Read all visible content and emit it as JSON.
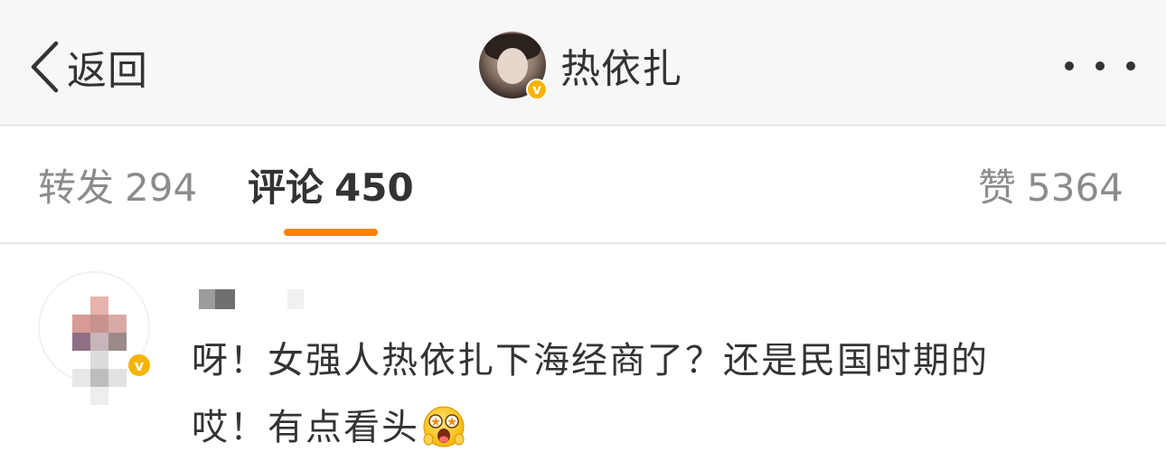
{
  "navbar": {
    "back_label": "返回",
    "back_icon": "chevron-left-icon",
    "title": "热依扎",
    "verified_badge": "v",
    "more_icon": "more-dots-icon"
  },
  "tabs": {
    "repost": {
      "label": "转发",
      "count": "294"
    },
    "comment": {
      "label": "评论",
      "count": "450",
      "active": true
    },
    "like": {
      "label": "赞",
      "count": "5364"
    },
    "accent_color": "#ff8200"
  },
  "comment": {
    "verified_badge": "v",
    "text_line1": "呀！女强人热依扎下海经商了？还是民国时期的",
    "text_line2": "哎！有点看头",
    "emoji": "star-eyes-emoji"
  },
  "colors": {
    "navbar_bg": "#f7f7f7",
    "text_primary": "#333333",
    "text_secondary": "#8c8c8c",
    "verified_badge": "#f5b400"
  }
}
